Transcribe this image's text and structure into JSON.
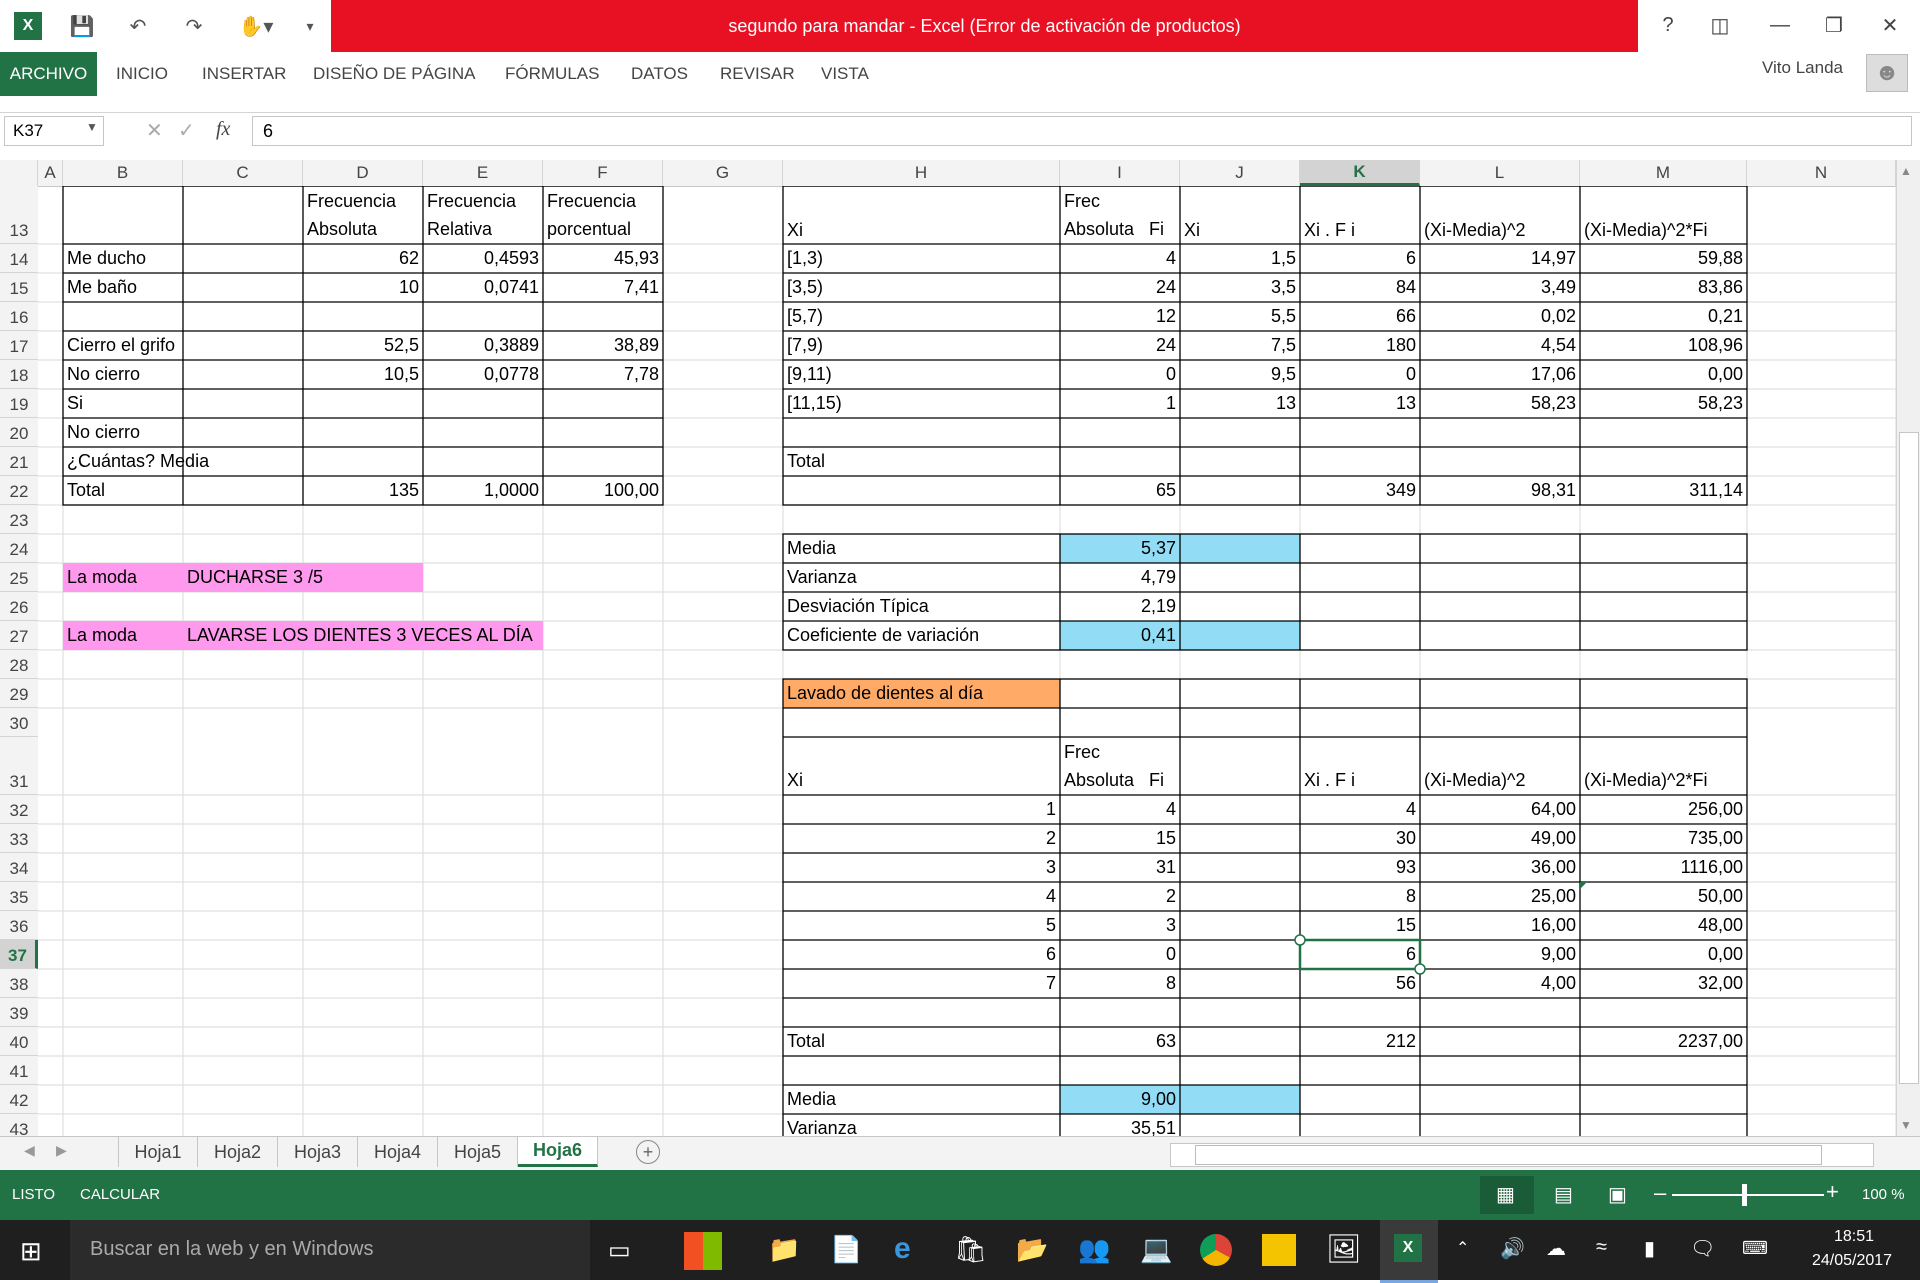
{
  "window": {
    "title": "segundo para mandar -  Excel (Error de activación de productos)",
    "user": "Vito Landa",
    "help": "?"
  },
  "ribbon": {
    "tabs": [
      "ARCHIVO",
      "INICIO",
      "INSERTAR",
      "DISEÑO DE PÁGINA",
      "FÓRMULAS",
      "DATOS",
      "REVISAR",
      "VISTA"
    ]
  },
  "formula_bar": {
    "name_box": "K37",
    "fx_label": "fx",
    "value": "6"
  },
  "columns": [
    "A",
    "B",
    "C",
    "D",
    "E",
    "F",
    "G",
    "H",
    "I",
    "J",
    "K",
    "L",
    "M",
    "N"
  ],
  "rows": [
    "13",
    "14",
    "15",
    "16",
    "17",
    "18",
    "19",
    "20",
    "21",
    "22",
    "23",
    "24",
    "25",
    "26",
    "27",
    "28",
    "29",
    "30",
    "31",
    "32",
    "33",
    "34",
    "35",
    "36",
    "37",
    "38",
    "39",
    "40",
    "41",
    "42",
    "43"
  ],
  "left_table": {
    "header": {
      "d": [
        "Frecuencia",
        "Absoluta"
      ],
      "e": [
        "Frecuencia",
        "Relativa"
      ],
      "f": [
        "Frecuencia",
        "porcentual"
      ]
    },
    "rows": [
      {
        "b": "Me ducho",
        "d": "62",
        "e": "0,4593",
        "f": "45,93"
      },
      {
        "b": "Me baño",
        "d": "10",
        "e": "0,0741",
        "f": "7,41"
      },
      {
        "b": "",
        "d": "",
        "e": "",
        "f": ""
      },
      {
        "b": "Cierro el grifo",
        "d": "52,5",
        "e": "0,3889",
        "f": "38,89"
      },
      {
        "b": "No cierro",
        "d": "10,5",
        "e": "0,0778",
        "f": "7,78"
      },
      {
        "b": "Si",
        "d": "",
        "e": "",
        "f": ""
      },
      {
        "b": "No cierro",
        "d": "",
        "e": "",
        "f": ""
      },
      {
        "b": "¿Cuántas? Media",
        "d": "",
        "e": "",
        "f": ""
      },
      {
        "b": "Total",
        "d": "135",
        "e": "1,0000",
        "f": "100,00"
      }
    ]
  },
  "moda": [
    {
      "label": "La moda",
      "text": "DUCHARSE 3 /5"
    },
    {
      "label": "La moda",
      "text": "LAVARSE LOS DIENTES 3 VECES AL DÍA"
    }
  ],
  "right_table1": {
    "header": {
      "h": "Xi",
      "i": [
        "Frec",
        "Absoluta   Fi"
      ],
      "j": "Xi",
      "k": "Xi . F i",
      "l": "(Xi-Media)^2",
      "m": "(Xi-Media)^2*Fi"
    },
    "rows": [
      {
        "h": "[1,3)",
        "i": "4",
        "j": "1,5",
        "k": "6",
        "l": "14,97",
        "m": "59,88"
      },
      {
        "h": "[3,5)",
        "i": "24",
        "j": "3,5",
        "k": "84",
        "l": "3,49",
        "m": "83,86"
      },
      {
        "h": "[5,7)",
        "i": "12",
        "j": "5,5",
        "k": "66",
        "l": "0,02",
        "m": "0,21"
      },
      {
        "h": "[7,9)",
        "i": "24",
        "j": "7,5",
        "k": "180",
        "l": "4,54",
        "m": "108,96"
      },
      {
        "h": "[9,11)",
        "i": "0",
        "j": "9,5",
        "k": "0",
        "l": "17,06",
        "m": "0,00"
      },
      {
        "h": "[11,15)",
        "i": "1",
        "j": "13",
        "k": "13",
        "l": "58,23",
        "m": "58,23"
      }
    ],
    "total_label": "Total",
    "totals": {
      "i": "65",
      "k": "349",
      "l": "98,31",
      "m": "311,14"
    },
    "stats": [
      {
        "label": "Media",
        "value": "5,37"
      },
      {
        "label": "Varianza",
        "value": "4,79"
      },
      {
        "label": "Desviación Típica",
        "value": "2,19"
      },
      {
        "label": "Coeficiente de variación",
        "value": "0,41"
      }
    ]
  },
  "right_table2": {
    "title": "Lavado de dientes al día",
    "header": {
      "h": "Xi",
      "i": [
        "Frec",
        "Absoluta   Fi"
      ],
      "k": "Xi . F i",
      "l": "(Xi-Media)^2",
      "m": "(Xi-Media)^2*Fi"
    },
    "rows": [
      {
        "h": "1",
        "i": "4",
        "k": "4",
        "l": "64,00",
        "m": "256,00"
      },
      {
        "h": "2",
        "i": "15",
        "k": "30",
        "l": "49,00",
        "m": "735,00"
      },
      {
        "h": "3",
        "i": "31",
        "k": "93",
        "l": "36,00",
        "m": "1116,00"
      },
      {
        "h": "4",
        "i": "2",
        "k": "8",
        "l": "25,00",
        "m": "50,00"
      },
      {
        "h": "5",
        "i": "3",
        "k": "15",
        "l": "16,00",
        "m": "48,00"
      },
      {
        "h": "6",
        "i": "0",
        "k": "6",
        "l": "9,00",
        "m": "0,00"
      },
      {
        "h": "7",
        "i": "8",
        "k": "56",
        "l": "4,00",
        "m": "32,00"
      }
    ],
    "total_label": "Total",
    "totals": {
      "i": "63",
      "k": "212",
      "m": "2237,00"
    },
    "stats": [
      {
        "label": "Media",
        "value": "9,00"
      },
      {
        "label": "Varianza",
        "value": "35,51"
      }
    ]
  },
  "sheets": [
    "Hoja1",
    "Hoja2",
    "Hoja3",
    "Hoja4",
    "Hoja5",
    "Hoja6"
  ],
  "active_sheet": "Hoja6",
  "status": {
    "ready": "LISTO",
    "calc": "CALCULAR",
    "zoom": "100 %"
  },
  "taskbar": {
    "search_placeholder": "Buscar en la web y en Windows",
    "time": "18:51",
    "date": "24/05/2017"
  },
  "colors": {
    "excel_green": "#217346",
    "title_red": "#e81123",
    "pink": "#ff99ee",
    "blue": "#92ddf5",
    "orange": "#ffaa66"
  }
}
